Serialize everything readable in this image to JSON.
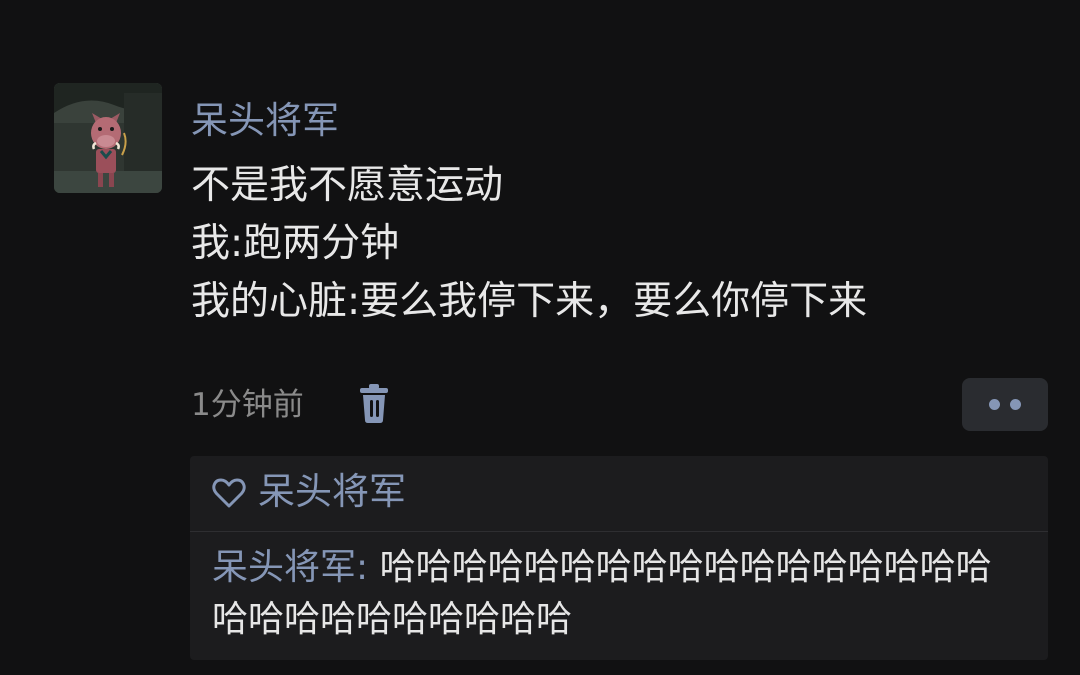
{
  "post": {
    "author": "呆头将军",
    "avatar_icon": "cartoon-boar-avatar-icon",
    "content_lines": [
      "不是我不愿意运动",
      "我:跑两分钟",
      "我的心脏:要么我停下来，要么你停下来"
    ],
    "time": "1分钟前",
    "delete_icon": "trash-icon",
    "more_icon": "two-dots-icon"
  },
  "likes": {
    "icon": "heart-outline-icon",
    "names": [
      "呆头将军"
    ]
  },
  "comments": [
    {
      "author": "呆头将军",
      "separator": ": ",
      "text": "哈哈哈哈哈哈哈哈哈哈哈哈哈哈哈哈哈哈哈哈哈哈哈哈哈哈哈"
    }
  ],
  "colors": {
    "background": "#111112",
    "name_blue": "#8596b6",
    "text": "#e6e6e6",
    "muted": "#8a8a8a",
    "panel": "#1c1c1e"
  }
}
